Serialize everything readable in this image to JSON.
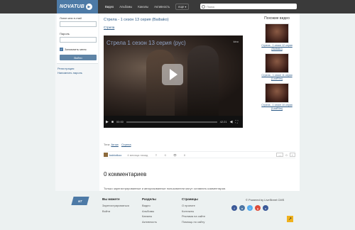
{
  "header": {
    "logo_text": "NOVATUB",
    "logo_mark": "▶",
    "nav": [
      {
        "label": "Видео"
      },
      {
        "label": "Альбомы"
      },
      {
        "label": "Каналы"
      },
      {
        "label": "Активность"
      }
    ],
    "more_label": "еще ▾",
    "search_placeholder": "Поиск"
  },
  "login": {
    "login_label": "Логин или e-mail",
    "password_label": "Пароль",
    "remember_label": "Запомнить меня",
    "login_button": "Войти",
    "register_link": "Регистрация",
    "forgot_link": "Напомнить пароль"
  },
  "video": {
    "title": "Стрела - 1 сезон 13 серия (Baibako)",
    "sub_link": "Стрела",
    "player_caption": "Стрела 1 сезон 13 серия (рус)",
    "channel_logo": "kino",
    "time_current": "00:00",
    "time_total": "42:21",
    "progress": 0.0,
    "meta_prefix": "Теги:",
    "tags": [
      "Arrow",
      "Стрела"
    ],
    "uploader": "babiotkoo",
    "added": "4 месяца назад",
    "share_count": "0",
    "views": "0",
    "rating_minus": "—",
    "rating_value": "0",
    "rating_plus": "+"
  },
  "comments": {
    "heading": "0 комментариев",
    "note": "Только зарегистрированные и авторизованные пользователи могут оставлять комментарии."
  },
  "similar": {
    "heading": "Похожие видео",
    "items": [
      {
        "title": "Стрела - 1 сезон 12 серия (Baibako)"
      },
      {
        "title": "Стрела - 1 сезон 11 серия (LostFilm)"
      },
      {
        "title": "Стрела - 1 сезон 10 серия (LostFilm)"
      }
    ]
  },
  "footer": {
    "logo_text": "NT",
    "col1": {
      "title": "Вы можете",
      "links": [
        "Зарегистрироваться",
        "Войти"
      ]
    },
    "col2": {
      "title": "Разделы",
      "links": [
        "Видео",
        "Альбомы",
        "Каналы",
        "Активность"
      ]
    },
    "col3": {
      "title": "Страницы",
      "links": [
        "О проекте",
        "Контакты",
        "Реклама на сайте",
        "Помощь по сайту"
      ]
    },
    "copyright": "© Powered by LiveStreet CMS",
    "socials": [
      {
        "name": "facebook-icon",
        "glyph": "f",
        "color": "#3b5998"
      },
      {
        "name": "vk-icon",
        "glyph": "в",
        "color": "#4c75a3"
      },
      {
        "name": "twitter-icon",
        "glyph": "t",
        "color": "#55acee"
      },
      {
        "name": "google-plus-icon",
        "glyph": "g",
        "color": "#dd4b39"
      },
      {
        "name": "odnoklassniki-icon",
        "glyph": "o",
        "color": "#3b5998"
      }
    ],
    "up_glyph": "↗"
  },
  "colors": {
    "brand": "#4d7aa6",
    "topbar": "#3a3a3a",
    "accent_yellow": "#f0b21e"
  }
}
